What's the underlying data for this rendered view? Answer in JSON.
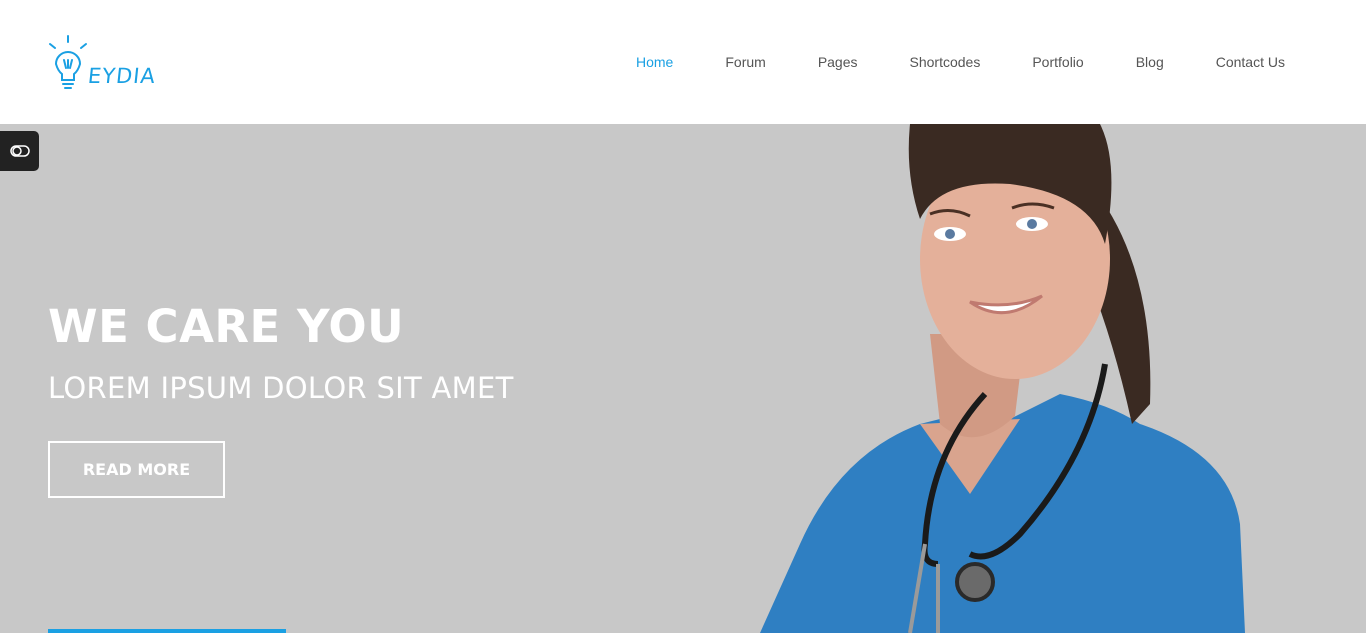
{
  "brand": {
    "logo_text": "EYDIA",
    "accent_color": "#1aa0e3"
  },
  "nav": {
    "items": [
      {
        "label": "Home",
        "active": true
      },
      {
        "label": "Forum",
        "active": false
      },
      {
        "label": "Pages",
        "active": false
      },
      {
        "label": "Shortcodes",
        "active": false
      },
      {
        "label": "Portfolio",
        "active": false
      },
      {
        "label": "Blog",
        "active": false
      },
      {
        "label": "Contact Us",
        "active": false
      }
    ]
  },
  "hero": {
    "title": "WE CARE YOU",
    "subtitle": "LOREM IPSUM DOLOR SIT AMET",
    "button_label": "READ MORE",
    "background_color": "#c8c8c8"
  },
  "toggle": {
    "icon": "toggle-icon"
  }
}
